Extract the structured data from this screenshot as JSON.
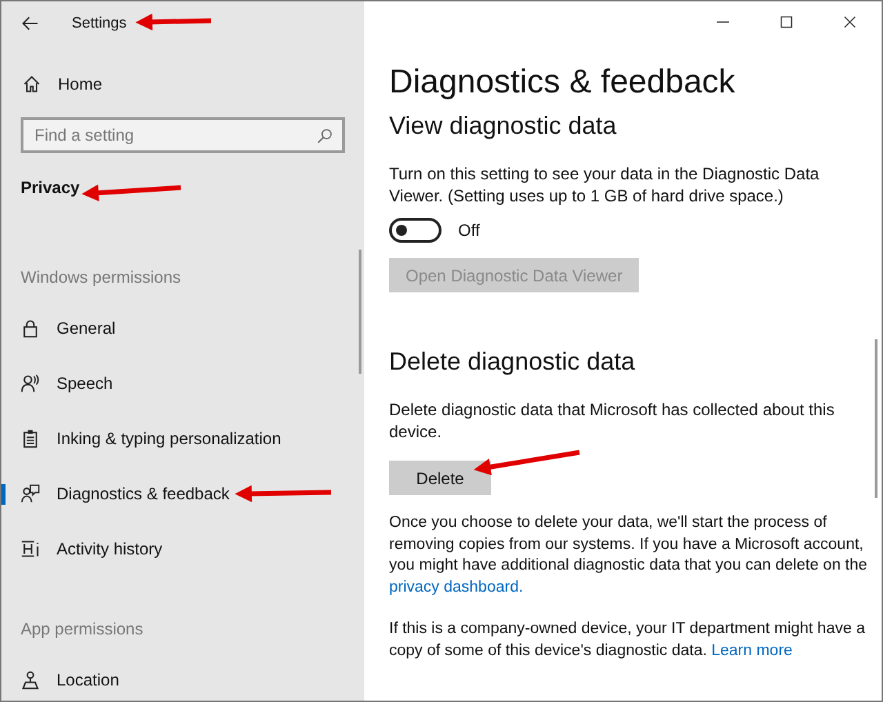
{
  "window": {
    "title": "Settings"
  },
  "sidebar": {
    "home": "Home",
    "search": {
      "placeholder": "Find a setting"
    },
    "section_title": "Privacy",
    "groups": [
      {
        "heading": "Windows permissions",
        "items": [
          {
            "label": "General",
            "kind": "lock",
            "selected": false
          },
          {
            "label": "Speech",
            "kind": "speech",
            "selected": false
          },
          {
            "label": "Inking & typing personalization",
            "kind": "clipboard",
            "selected": false
          },
          {
            "label": "Diagnostics & feedback",
            "kind": "feedback",
            "selected": true
          },
          {
            "label": "Activity history",
            "kind": "history",
            "selected": false
          }
        ]
      },
      {
        "heading": "App permissions",
        "items": [
          {
            "label": "Location",
            "kind": "location",
            "selected": false
          }
        ]
      }
    ]
  },
  "page": {
    "title": "Diagnostics & feedback",
    "sections": [
      {
        "heading": "View diagnostic data",
        "description": "Turn on this setting to see your data in the Diagnostic Data Viewer. (Setting uses up to 1 GB of hard drive space.)",
        "toggle": {
          "on": false,
          "label": "Off"
        },
        "button": {
          "label": "Open Diagnostic Data Viewer",
          "disabled": true
        }
      },
      {
        "heading": "Delete diagnostic data",
        "description": "Delete diagnostic data that Microsoft has collected about this device.",
        "button": {
          "label": "Delete",
          "disabled": false
        },
        "notes": [
          {
            "text": "Once you choose to delete your data, we'll start the process of removing copies from our systems. If you have a Microsoft account, you might have additional diagnostic data that you can delete on the ",
            "link": "privacy dashboard."
          },
          {
            "text": "If this is a company-owned device, your IT department might have a copy of some of this device's diagnostic data. ",
            "link": "Learn more"
          }
        ]
      }
    ]
  }
}
